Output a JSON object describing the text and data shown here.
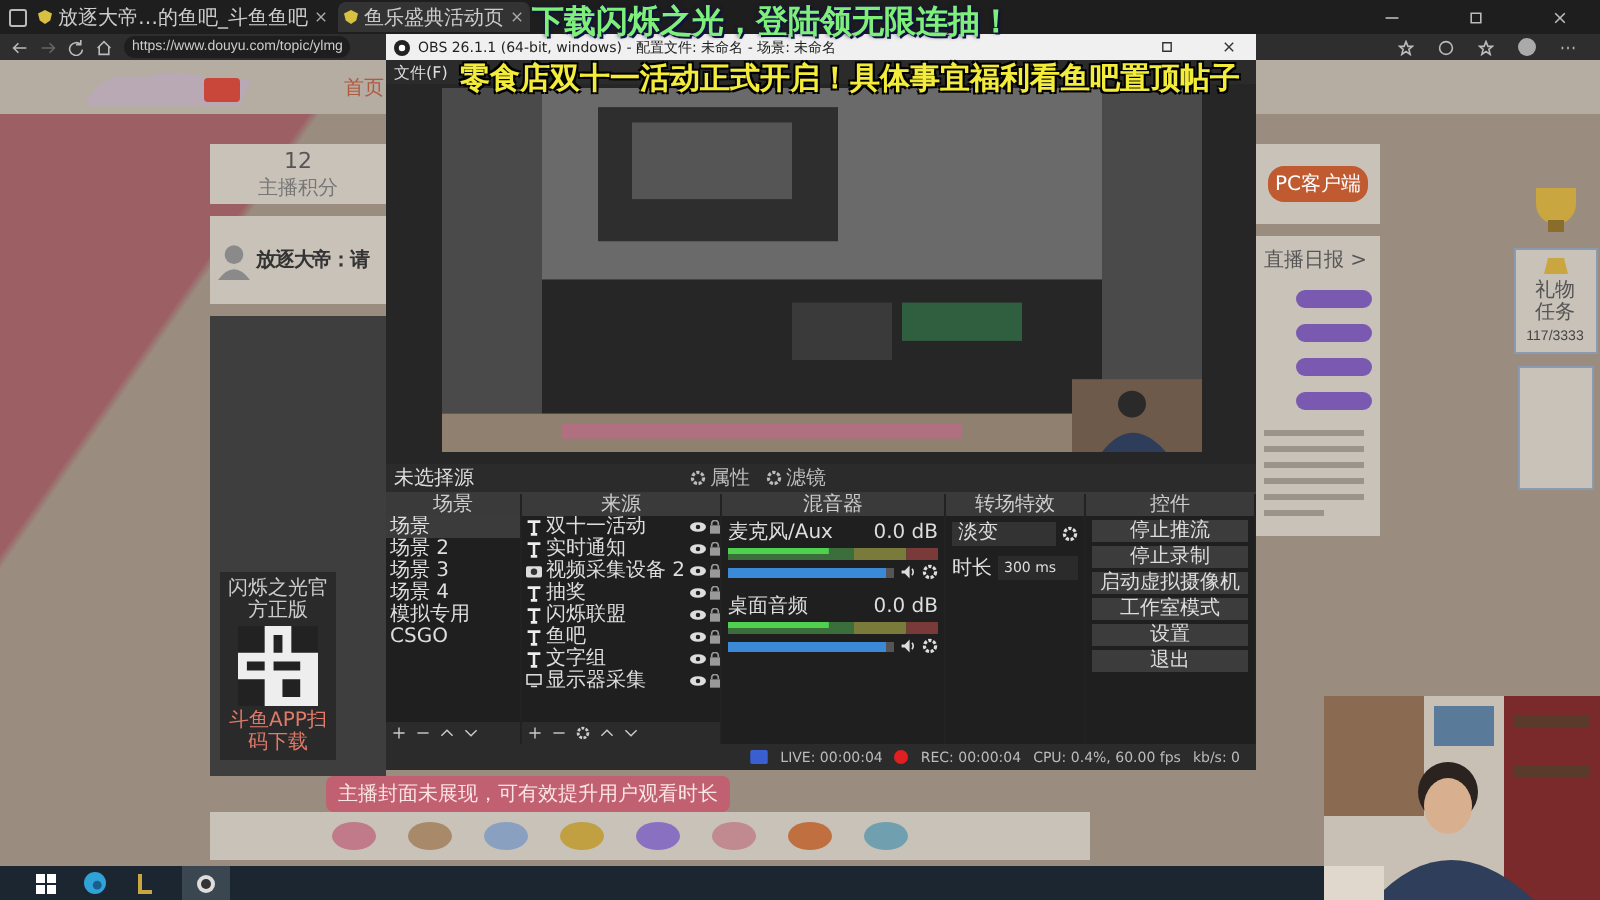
{
  "browser": {
    "tabs": [
      {
        "title": "放逐大帝…的鱼吧_斗鱼鱼吧",
        "selected": false
      },
      {
        "title": "鱼乐盛典活动页",
        "selected": true
      }
    ],
    "url": "https://www.douyu.com/topic/ylmg"
  },
  "overlays": {
    "top": "下载闪烁之光，登陆领无限连抽！",
    "banner": "零食店双十一活动正式开启！具体事宜福利看鱼吧置顶帖子"
  },
  "site": {
    "nav": [
      "首页"
    ],
    "stat": {
      "value": "12",
      "label": "主播积分"
    },
    "profile": {
      "name": "放逐大帝：请"
    },
    "qr": {
      "title": "闪烁之光官方正版",
      "caption": "斗鱼APP扫码下载"
    },
    "toast": "主播封面未展现，可有效提升用户观看时长",
    "client_button": "PC客户端",
    "report_link": "直播日报 >",
    "task": {
      "title": "礼物任务",
      "progress": "117/3333"
    }
  },
  "obs": {
    "title": "OBS 26.1.1 (64-bit, windows) - 配置文件: 未命名 - 场景: 未命名",
    "menu": [
      "文件(F)"
    ],
    "source_bar": {
      "label": "未选择源",
      "buttons": [
        "属性",
        "滤镜"
      ]
    },
    "docks": {
      "scenes": "场景",
      "sources": "来源",
      "mixer": "混音器",
      "transitions": "转场特效",
      "controls": "控件"
    },
    "scenes": [
      {
        "name": "场景",
        "selected": true
      },
      {
        "name": "场景 2",
        "selected": false
      },
      {
        "name": "场景 3",
        "selected": false
      },
      {
        "name": "场景 4",
        "selected": false
      },
      {
        "name": "模拟专用",
        "selected": false
      },
      {
        "name": "CSGO",
        "selected": false
      }
    ],
    "sources": [
      {
        "name": "双十一活动",
        "kind": "text"
      },
      {
        "name": "实时通知",
        "kind": "text"
      },
      {
        "name": "视频采集设备 2",
        "kind": "camera"
      },
      {
        "name": "抽奖",
        "kind": "text"
      },
      {
        "name": "闪烁联盟",
        "kind": "text"
      },
      {
        "name": "鱼吧",
        "kind": "text"
      },
      {
        "name": "文字组",
        "kind": "text"
      },
      {
        "name": "显示器采集",
        "kind": "display"
      }
    ],
    "mixer": [
      {
        "name": "麦克风/Aux",
        "reading": "0.0 dB",
        "level": 0.95
      },
      {
        "name": "桌面音频",
        "reading": "0.0 dB",
        "level": 0.95
      }
    ],
    "transition": {
      "type": "淡变",
      "duration_label": "时长",
      "duration": "300 ms"
    },
    "controls": [
      "停止推流",
      "停止录制",
      "启动虚拟摄像机",
      "工作室模式",
      "设置",
      "退出"
    ],
    "status": {
      "live": "LIVE: 00:00:04",
      "rec": "REC: 00:00:04",
      "cpu": "CPU: 0.4%, 60.00 fps",
      "kbps": "kb/s: 0"
    }
  }
}
